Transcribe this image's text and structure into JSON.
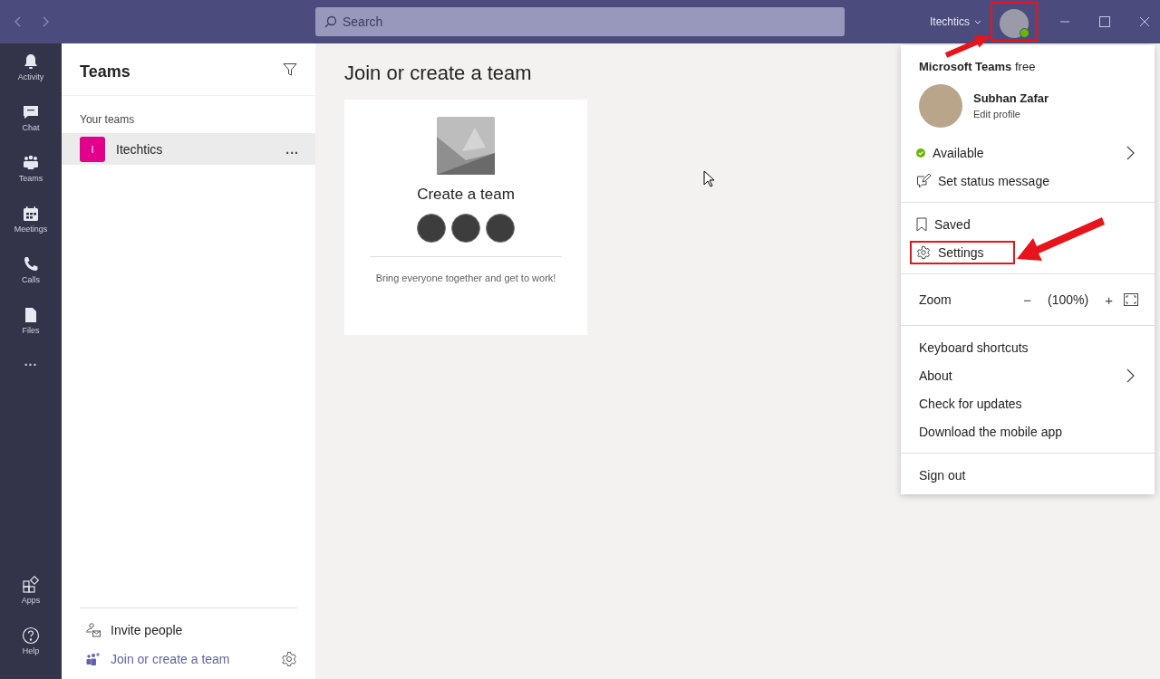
{
  "title_bar": {
    "search": {
      "placeholder": "Search"
    },
    "org": "Itechtics",
    "avatar": {
      "highlighted": true
    }
  },
  "app_bar": {
    "top": [
      {
        "label": "Activity"
      },
      {
        "label": "Chat"
      },
      {
        "label": "Teams"
      },
      {
        "label": "Meetings"
      },
      {
        "label": "Calls"
      },
      {
        "label": "Files"
      }
    ],
    "more": "...",
    "bottom": [
      {
        "label": "Apps"
      },
      {
        "label": "Help"
      }
    ]
  },
  "teams_panel": {
    "title": "Teams",
    "section": "Your teams",
    "teams": [
      {
        "initial": "I",
        "name": "Itechtics",
        "color": "#e3008c",
        "selected": true,
        "more": "..."
      }
    ],
    "footer": [
      {
        "label": "Invite people",
        "kind": "invite"
      },
      {
        "label": "Join or create a team",
        "kind": "join"
      }
    ]
  },
  "main": {
    "heading": "Join or create a team",
    "card": {
      "title": "Create a team",
      "caption": "Bring everyone together and get to work!"
    }
  },
  "profile_menu": {
    "product": "**Microsoft Teams** free",
    "name": "Subhan Zafar",
    "edit": "Edit profile",
    "groups": [
      [
        {
          "kind": "status",
          "label": "Available",
          "submenu": true,
          "highlighted": false
        },
        {
          "kind": "edit",
          "label": "Set status message",
          "submenu": false,
          "highlighted": false
        }
      ],
      [
        {
          "kind": "bookmark",
          "label": "Saved",
          "submenu": false,
          "highlighted": false
        },
        {
          "kind": "gear",
          "label": "Settings",
          "submenu": false,
          "highlighted": true
        }
      ],
      [
        {
          "kind": "zoom",
          "label": "Zoom",
          "minus": "−",
          "value": "(100%)",
          "plus": "+"
        }
      ],
      [
        {
          "kind": "plain",
          "label": "Keyboard shortcuts",
          "submenu": false,
          "highlighted": false
        },
        {
          "kind": "plain",
          "label": "About",
          "submenu": true,
          "highlighted": false
        },
        {
          "kind": "plain",
          "label": "Check for updates",
          "submenu": false,
          "highlighted": false
        },
        {
          "kind": "plain",
          "label": "Download the mobile app",
          "submenu": false,
          "highlighted": false
        }
      ],
      [
        {
          "kind": "plain",
          "label": "Sign out",
          "submenu": false,
          "highlighted": false
        }
      ]
    ]
  }
}
